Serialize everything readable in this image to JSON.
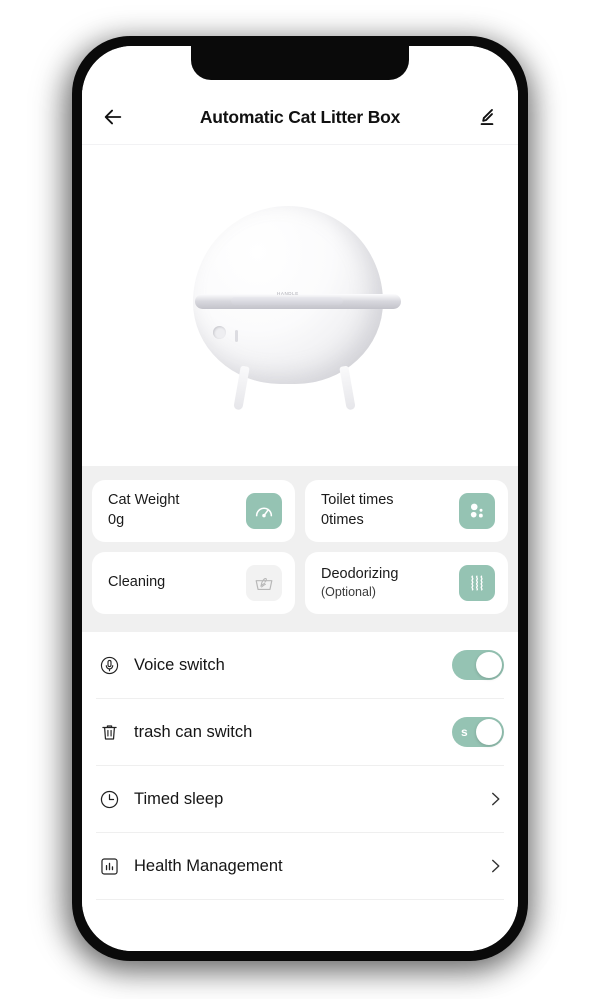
{
  "header": {
    "title": "Automatic Cat Litter Box",
    "back_icon": "arrow-left-icon",
    "edit_icon": "pencil-edit-icon"
  },
  "hero": {
    "product_icon": "cat-litter-box-product-image",
    "brand_mark": "HANDLE"
  },
  "stats": [
    {
      "label": "Cat Weight",
      "value": "0g",
      "icon": "gauge-icon",
      "icon_active": true
    },
    {
      "label": "Toilet times",
      "value": "0times",
      "icon": "litter-dots-icon",
      "icon_active": true
    },
    {
      "label": "Cleaning",
      "value": "",
      "icon": "wash-basin-icon",
      "icon_active": false
    },
    {
      "label": "Deodorizing",
      "value": "(Optional)",
      "icon": "deodorize-waves-icon",
      "icon_active": true
    }
  ],
  "list": [
    {
      "label": "Voice switch",
      "icon": "microphone-icon",
      "control": "toggle",
      "toggle_on": true,
      "toggle_tag": ""
    },
    {
      "label": "trash can switch",
      "icon": "trash-can-icon",
      "control": "toggle",
      "toggle_on": true,
      "toggle_tag": "s"
    },
    {
      "label": "Timed sleep",
      "icon": "clock-icon",
      "control": "chevron",
      "chevron_icon": "chevron-right-icon"
    },
    {
      "label": "Health Management",
      "icon": "bar-chart-icon",
      "control": "chevron",
      "chevron_icon": "chevron-right-icon"
    }
  ],
  "colors": {
    "accent_green": "#95c3b3",
    "section_background": "#f0f0f0",
    "card_background": "#ffffff",
    "text_primary": "#151515"
  }
}
